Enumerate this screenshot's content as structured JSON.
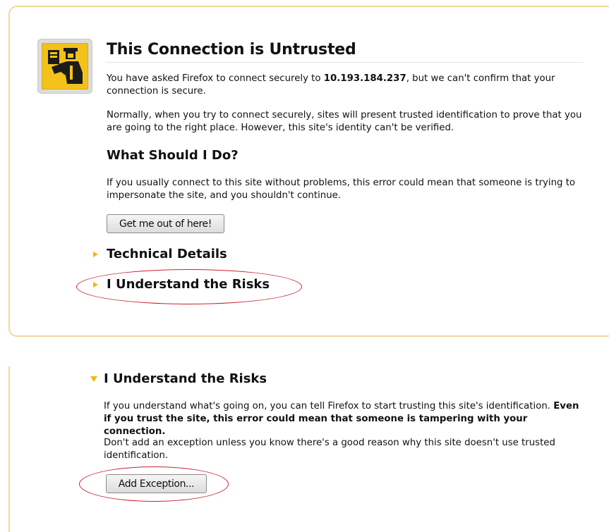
{
  "top": {
    "title": "This Connection is Untrusted",
    "intro_prefix": "You have asked Firefox to connect securely to ",
    "intro_host": "10.193.184.237",
    "intro_suffix": ", but we can't confirm that your connection is secure.",
    "normally": "Normally, when you try to connect securely, sites will present trusted identification to prove that you are going to the right place. However, this site's identity can't be verified.",
    "what_heading": "What Should I Do?",
    "what_text": "If you usually connect to this site without problems, this error could mean that someone is trying to impersonate the site, and you shouldn't continue.",
    "get_out_button": "Get me out of here!",
    "technical_details": "Technical Details",
    "understand_risks": "I Understand the Risks"
  },
  "bottom": {
    "heading": "I Understand the Risks",
    "text_prefix": "If you understand what's going on, you can tell Firefox to start trusting this site's identification. ",
    "text_bold": "Even if you trust the site, this error could mean that someone is tampering with your connection.",
    "dont_add": "Don't add an exception unless you know there's a good reason why this site doesn't use trusted identification.",
    "add_exception_button": "Add Exception..."
  },
  "colors": {
    "panel_border": "#f2d99a",
    "arrow": "#f5b800",
    "annotation": "#cc2233",
    "icon_yellow": "#f2c21b"
  },
  "icons": {
    "warning_icon": "border-guard-icon",
    "expander": "triangle-icon"
  }
}
